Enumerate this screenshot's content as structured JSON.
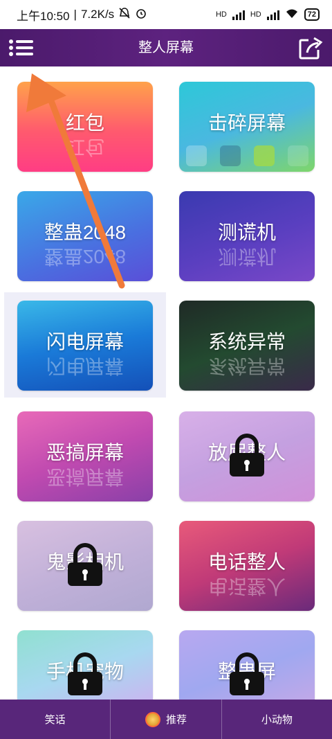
{
  "status": {
    "time": "上午10:50",
    "speed": "7.2K/s",
    "net1": "HD",
    "net2": "HD",
    "battery": "72"
  },
  "appbar": {
    "title": "整人屏幕",
    "menu_icon": "menu-icon",
    "share_icon": "share-icon"
  },
  "cards": [
    {
      "label": "红包",
      "locked": false
    },
    {
      "label": "击碎屏幕",
      "locked": false
    },
    {
      "label": "整蛊2048",
      "locked": false
    },
    {
      "label": "测谎机",
      "locked": false
    },
    {
      "label": "闪电屏幕",
      "locked": false
    },
    {
      "label": "系统异常",
      "locked": false
    },
    {
      "label": "恶搞屏幕",
      "locked": false
    },
    {
      "label": "放屁整人",
      "locked": true
    },
    {
      "label": "鬼影相机",
      "locked": true
    },
    {
      "label": "电话整人",
      "locked": false
    },
    {
      "label": "手机宠物",
      "locked": true
    },
    {
      "label": "整蛊屏",
      "locked": true
    }
  ],
  "tabs": [
    {
      "label": "笑话"
    },
    {
      "label": "推荐"
    },
    {
      "label": "小动物"
    }
  ],
  "colors": {
    "appbar": "#5d227f",
    "tabbar": "#58267a",
    "annotation_arrow": "#f07a3a"
  }
}
